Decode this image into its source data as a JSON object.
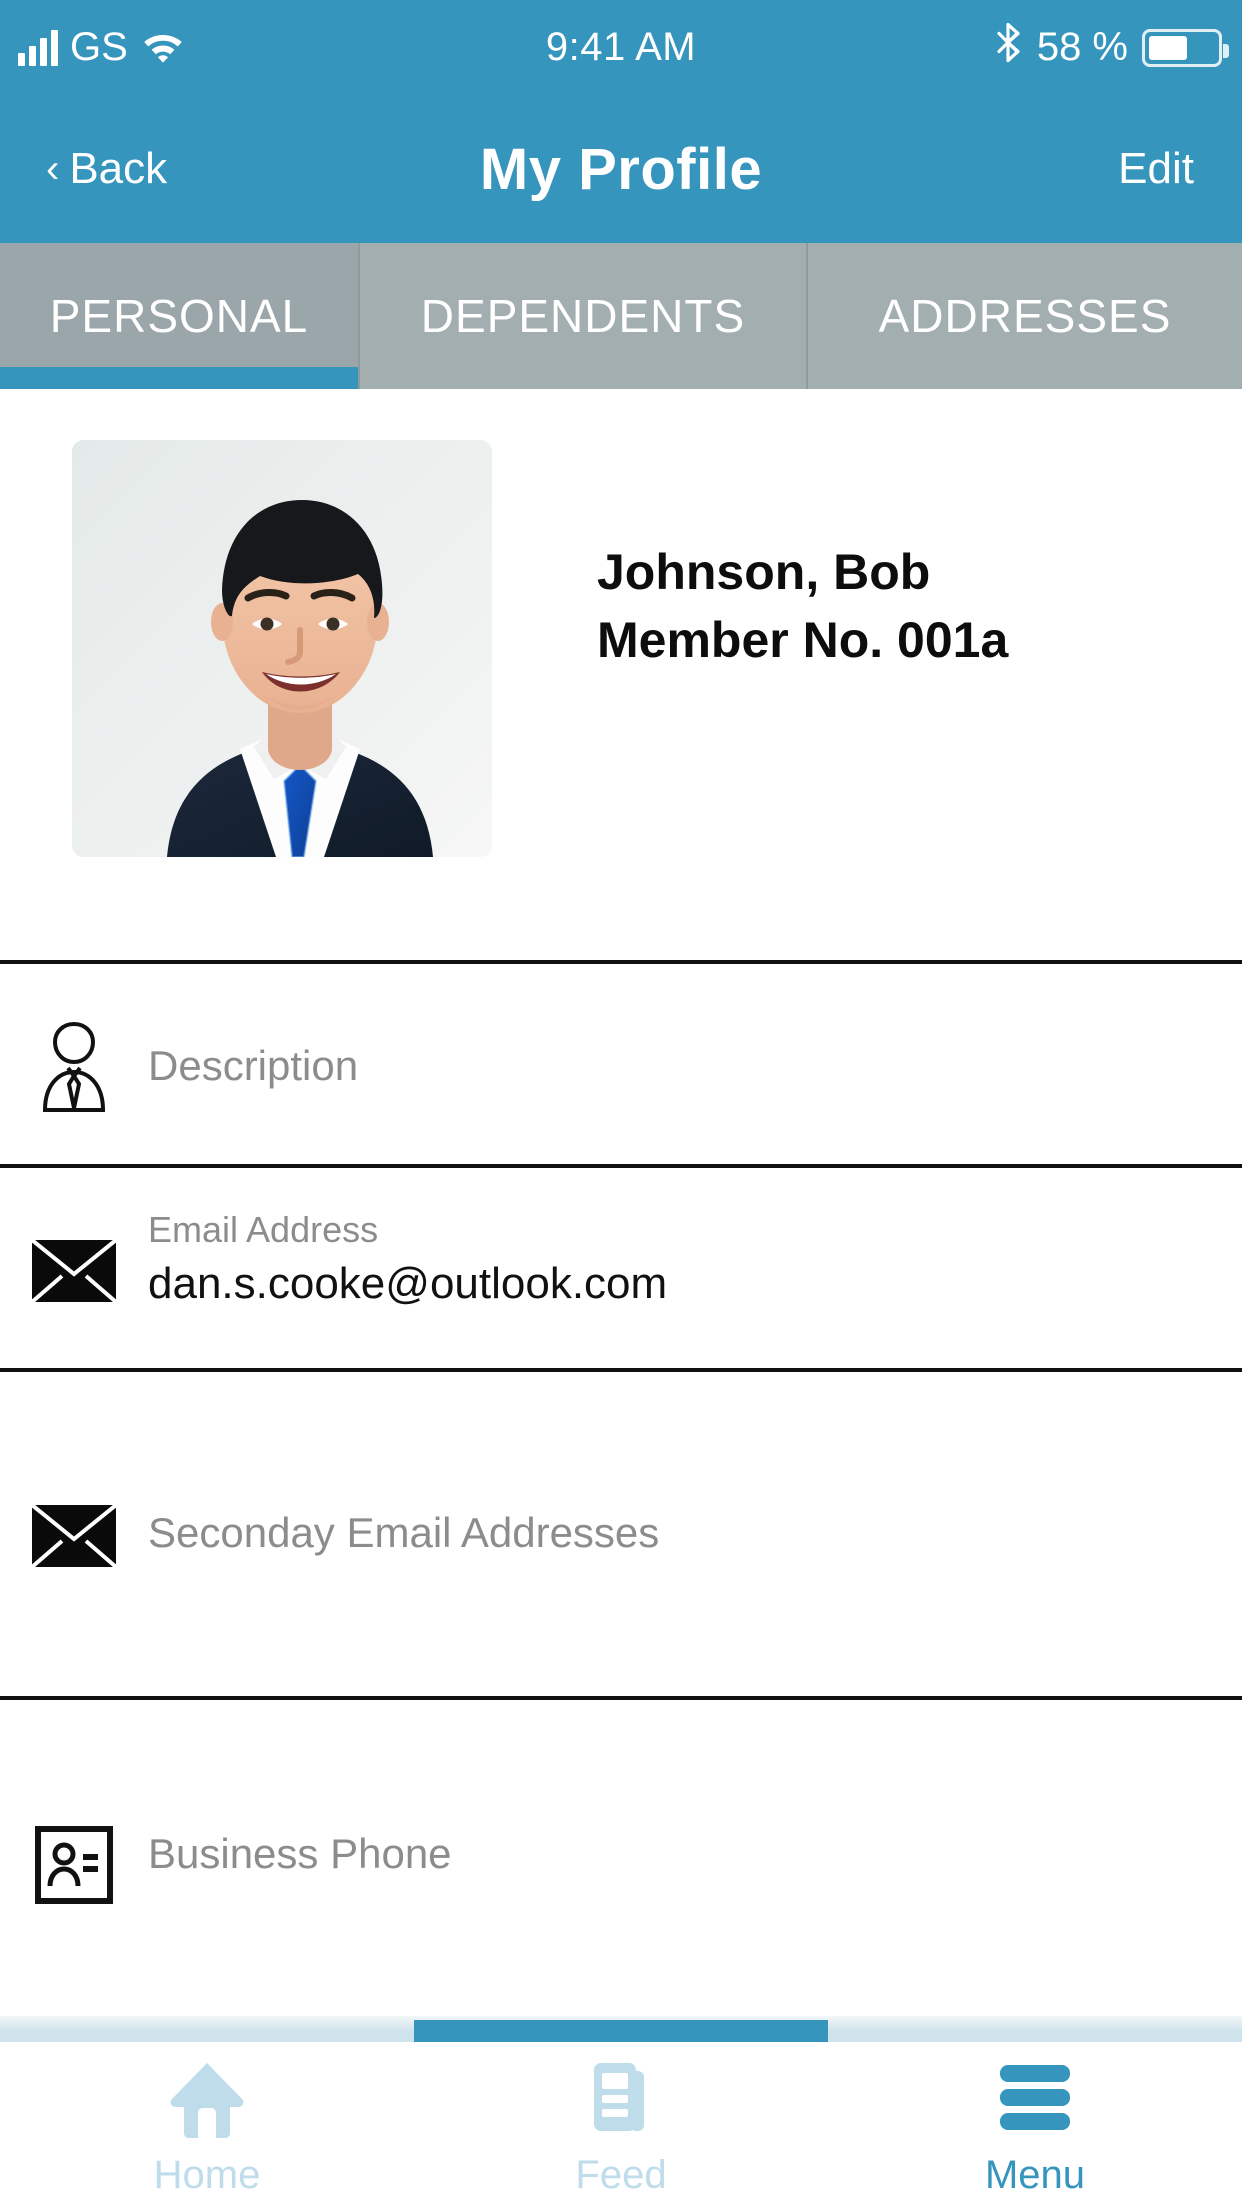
{
  "statusbar": {
    "carrier": "GS",
    "time": "9:41 AM",
    "battery_percent": "58 %",
    "signal_icon": "signal-bars-icon",
    "wifi_icon": "wifi-icon",
    "bluetooth_icon": "bluetooth-icon",
    "battery_icon": "battery-icon"
  },
  "navbar": {
    "back_label": "Back",
    "back_chevron": "‹",
    "title": "My Profile",
    "edit_label": "Edit"
  },
  "tabs": {
    "items": [
      {
        "label": "PERSONAL",
        "active": true
      },
      {
        "label": "DEPENDENTS",
        "active": false
      },
      {
        "label": "ADDRESSES",
        "active": false
      }
    ]
  },
  "profile": {
    "avatar_icon": "profile-photo",
    "name": "Johnson, Bob",
    "member_no": "Member No. 001a"
  },
  "fields": [
    {
      "key": "description",
      "icon": "business-person-icon",
      "label": "Description",
      "value": "",
      "has_value": false
    },
    {
      "key": "email",
      "icon": "envelope-icon",
      "label": "Email Address",
      "value": "dan.s.cooke@outlook.com",
      "has_value": true
    },
    {
      "key": "secondary_email",
      "icon": "envelope-icon",
      "label": "Seconday Email Addresses",
      "value": "",
      "has_value": false
    },
    {
      "key": "business_phone",
      "icon": "contact-card-icon",
      "label": "Business Phone",
      "value": "",
      "has_value": false
    }
  ],
  "bottombar": {
    "items": [
      {
        "label": "Home",
        "icon": "home-icon",
        "active": false
      },
      {
        "label": "Feed",
        "icon": "feed-icon",
        "active": false
      },
      {
        "label": "Menu",
        "icon": "hamburger-menu-icon",
        "active": true
      }
    ]
  },
  "colors": {
    "brand_blue": "#3595bd",
    "tab_gray": "#a3aeb0",
    "tab_gray_active": "#9aa6a9",
    "inactive_blue": "#bfdcea",
    "label_gray": "#8c8c8c"
  }
}
